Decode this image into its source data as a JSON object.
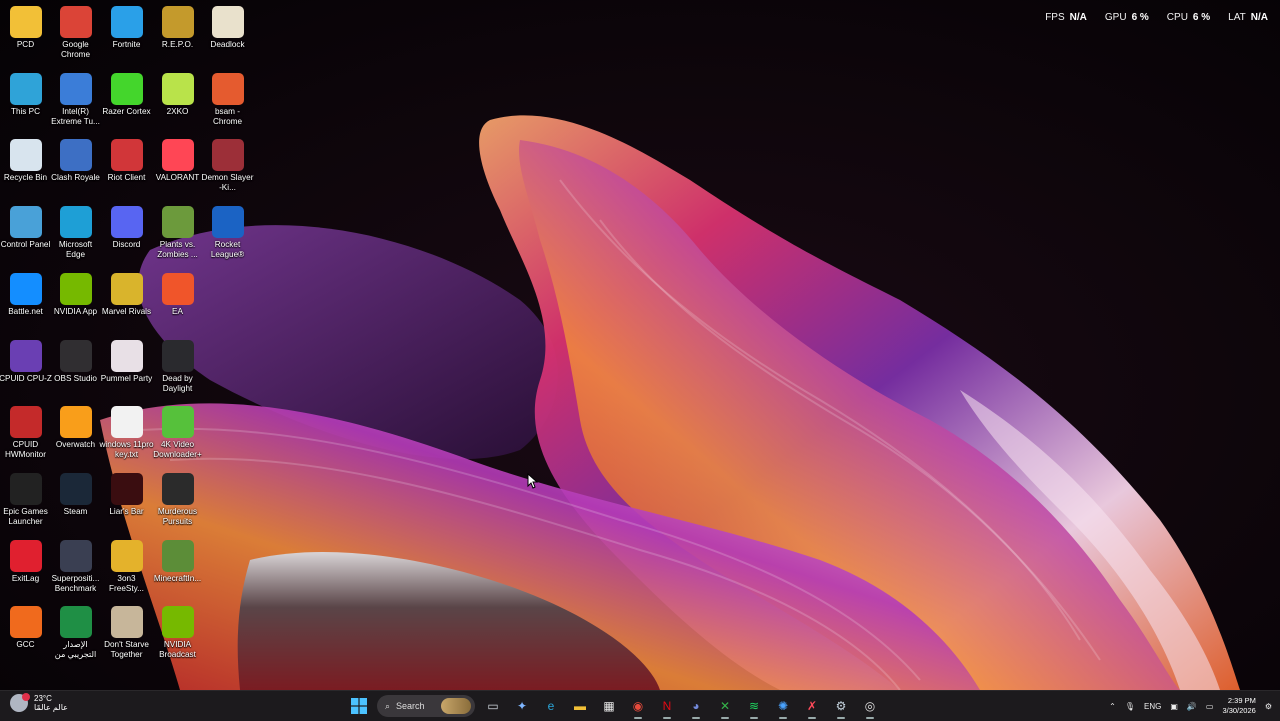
{
  "overlay": {
    "fps": {
      "label": "FPS",
      "value": "N/A"
    },
    "gpu": {
      "label": "GPU",
      "value": "6 %"
    },
    "cpu": {
      "label": "CPU",
      "value": "6 %"
    },
    "lat": {
      "label": "LAT",
      "value": "N/A"
    }
  },
  "desktop": {
    "icons": [
      {
        "label": "PCD",
        "icon": "folder-icon",
        "color": "#f2c037"
      },
      {
        "label": "Google Chrome",
        "icon": "chrome-icon",
        "color": "#db4437"
      },
      {
        "label": "Fortnite",
        "icon": "fortnite-icon",
        "color": "#2aa0e8"
      },
      {
        "label": "R.E.P.O.",
        "icon": "repo-icon",
        "color": "#c49a2c"
      },
      {
        "label": "Deadlock",
        "icon": "deadlock-icon",
        "color": "#e9e1cc"
      },
      {
        "label": "This PC",
        "icon": "monitor-icon",
        "color": "#2fa3d8"
      },
      {
        "label": "Intel(R) Extreme Tu...",
        "icon": "intel-xtu-icon",
        "color": "#3b7dd8"
      },
      {
        "label": "Razer Cortex",
        "icon": "razer-cortex-icon",
        "color": "#44d62c"
      },
      {
        "label": "2XKO",
        "icon": "2xko-icon",
        "color": "#b9e34a"
      },
      {
        "label": "bsam - Chrome",
        "icon": "chrome-profile-icon",
        "color": "#e55b2f"
      },
      {
        "label": "Recycle Bin",
        "icon": "recycle-bin-icon",
        "color": "#d8e4ee"
      },
      {
        "label": "Clash Royale",
        "icon": "clash-royale-icon",
        "color": "#3d6fc4"
      },
      {
        "label": "Riot Client",
        "icon": "riot-client-icon",
        "color": "#d13639"
      },
      {
        "label": "VALORANT",
        "icon": "valorant-icon",
        "color": "#ff4655"
      },
      {
        "label": "Demon Slayer -Ki...",
        "icon": "demon-slayer-icon",
        "color": "#9c2f38"
      },
      {
        "label": "Control Panel",
        "icon": "control-panel-icon",
        "color": "#49a1d8"
      },
      {
        "label": "Microsoft Edge",
        "icon": "edge-icon",
        "color": "#1e9fd6"
      },
      {
        "label": "Discord",
        "icon": "discord-icon",
        "color": "#5865f2"
      },
      {
        "label": "Plants vs. Zombies ...",
        "icon": "pvz-icon",
        "color": "#6c9a3c"
      },
      {
        "label": "Rocket League®",
        "icon": "rocket-league-icon",
        "color": "#1b63c4"
      },
      {
        "label": "Battle.net",
        "icon": "battlenet-icon",
        "color": "#148eff"
      },
      {
        "label": "NVIDIA App",
        "icon": "nvidia-icon",
        "color": "#76b900"
      },
      {
        "label": "Marvel Rivals",
        "icon": "marvel-rivals-icon",
        "color": "#d9b42c"
      },
      {
        "label": "EA",
        "icon": "ea-icon",
        "color": "#f0552a"
      },
      {
        "label": "",
        "icon": "",
        "color": ""
      },
      {
        "label": "CPUID CPU-Z",
        "icon": "cpuz-icon",
        "color": "#6a3fb3"
      },
      {
        "label": "OBS Studio",
        "icon": "obs-icon",
        "color": "#302e31"
      },
      {
        "label": "Pummel Party",
        "icon": "pummel-party-icon",
        "color": "#e8e0e6"
      },
      {
        "label": "Dead by Daylight",
        "icon": "dbd-icon",
        "color": "#2a2a2e"
      },
      {
        "label": "",
        "icon": "",
        "color": ""
      },
      {
        "label": "CPUID HWMonitor",
        "icon": "hwmonitor-icon",
        "color": "#c42a2a"
      },
      {
        "label": "Overwatch",
        "icon": "overwatch-icon",
        "color": "#f99e1a"
      },
      {
        "label": "windows 11pro key.txt",
        "icon": "text-file-icon",
        "color": "#f2f2f2"
      },
      {
        "label": "4K Video Downloader+",
        "icon": "4k-downloader-icon",
        "color": "#56c13b"
      },
      {
        "label": "",
        "icon": "",
        "color": ""
      },
      {
        "label": "Epic Games Launcher",
        "icon": "epic-games-icon",
        "color": "#222"
      },
      {
        "label": "Steam",
        "icon": "steam-icon",
        "color": "#1b2838"
      },
      {
        "label": "Liar's Bar",
        "icon": "liars-bar-icon",
        "color": "#3a0d10"
      },
      {
        "label": "Murderous Pursuits",
        "icon": "murderous-pursuits-icon",
        "color": "#2b2b2b"
      },
      {
        "label": "",
        "icon": "",
        "color": ""
      },
      {
        "label": "ExitLag",
        "icon": "exitlag-icon",
        "color": "#e0202f"
      },
      {
        "label": "Superpositi... Benchmark",
        "icon": "superposition-icon",
        "color": "#3a3f52"
      },
      {
        "label": "3on3 FreeSty...",
        "icon": "3on3-freestyle-icon",
        "color": "#e4b22b"
      },
      {
        "label": "MinecraftIn...",
        "icon": "minecraft-icon",
        "color": "#5c8d38"
      },
      {
        "label": "",
        "icon": "",
        "color": ""
      },
      {
        "label": "GCC",
        "icon": "gcc-icon",
        "color": "#f06a1d"
      },
      {
        "label": "الإصدار التجريبي من",
        "icon": "gamepass-beta-icon",
        "color": "#1f8f45"
      },
      {
        "label": "Don't Starve Together",
        "icon": "dont-starve-icon",
        "color": "#c7b69a"
      },
      {
        "label": "NVIDIA Broadcast",
        "icon": "nvidia-broadcast-icon",
        "color": "#76b900"
      }
    ]
  },
  "taskbar": {
    "weather": {
      "temp": "23°C",
      "desc": "عالم عالمًا"
    },
    "search_placeholder": "Search",
    "apps": [
      {
        "name": "task-view-icon",
        "glyph": "▭",
        "color": "#cfd6dd"
      },
      {
        "name": "copilot-icon",
        "glyph": "✦",
        "color": "#7fb6ff"
      },
      {
        "name": "edge-icon",
        "glyph": "e",
        "color": "#2aa5d8"
      },
      {
        "name": "file-explorer-icon",
        "glyph": "▬",
        "color": "#f2c037"
      },
      {
        "name": "microsoft-store-icon",
        "glyph": "▦",
        "color": "#e6e6e6"
      },
      {
        "name": "chrome-icon",
        "glyph": "◉",
        "color": "#e84b3c"
      },
      {
        "name": "netflix-icon",
        "glyph": "N",
        "color": "#e50914"
      },
      {
        "name": "discord-icon",
        "glyph": "◕",
        "color": "#7289da"
      },
      {
        "name": "xbox-icon",
        "glyph": "✕",
        "color": "#35b34a"
      },
      {
        "name": "spotify-icon",
        "glyph": "≋",
        "color": "#1ed760"
      },
      {
        "name": "battlenet-icon",
        "glyph": "✺",
        "color": "#4aa3ff"
      },
      {
        "name": "exitlag-icon",
        "glyph": "✗",
        "color": "#ff4a5a"
      },
      {
        "name": "steam-icon",
        "glyph": "⚙",
        "color": "#c7d5e0"
      },
      {
        "name": "obs-icon",
        "glyph": "◎",
        "color": "#e0e0e0"
      }
    ],
    "tray": {
      "lang": "ENG",
      "time": "2:39 PM",
      "date": "3/30/2026"
    }
  }
}
